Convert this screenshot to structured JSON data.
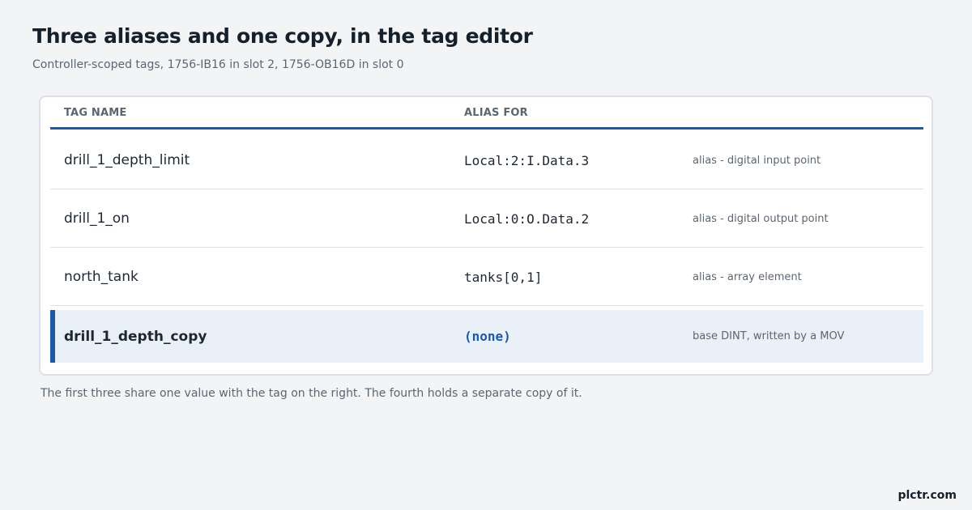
{
  "title": "Three aliases and one copy, in the tag editor",
  "subtitle": "Controller-scoped tags, 1756-IB16 in slot 2, 1756-OB16D in slot 0",
  "table": {
    "headers": {
      "name": "TAG NAME",
      "alias": "ALIAS FOR"
    },
    "rows": [
      {
        "name": "drill_1_depth_limit",
        "alias": "Local:2:I.Data.3",
        "note": "alias - digital input point"
      },
      {
        "name": "drill_1_on",
        "alias": "Local:0:O.Data.2",
        "note": "alias - digital output point"
      },
      {
        "name": "north_tank",
        "alias": "tanks[0,1]",
        "note": "alias - array element"
      },
      {
        "name": "drill_1_depth_copy",
        "alias": "(none)",
        "note": "base DINT, written by a MOV"
      }
    ]
  },
  "footnote": "The first three share one value with the tag on the right. The fourth holds a separate copy of it.",
  "brand": "plctr.com",
  "colors": {
    "accent": "#1c5aa6",
    "highlight_row": "#eaf0f8"
  }
}
